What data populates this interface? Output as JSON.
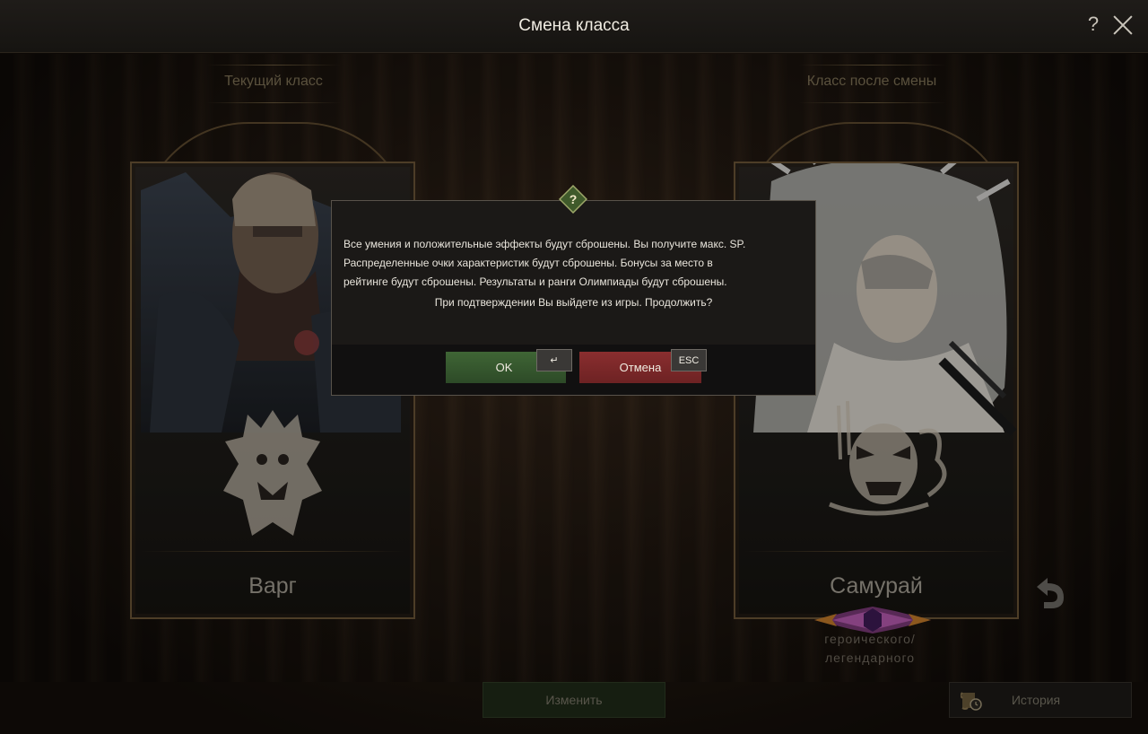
{
  "window": {
    "title": "Смена класса"
  },
  "left_panel": {
    "label": "Текущий класс",
    "class_name": "Варг",
    "emblem": "wolf-crest-emblem"
  },
  "right_panel": {
    "label": "Класс после смены",
    "class_name": "Самурай",
    "emblem": "oni-mask-emblem",
    "rank_line1": "героического/",
    "rank_line2": "легендарного"
  },
  "buttons": {
    "change": "Изменить",
    "history": "История"
  },
  "dialog": {
    "icon": "question-icon",
    "message_line1": "Все умения и положительные эффекты будут сброшены. Вы получите макс. SP.",
    "message_line2": "Распределенные очки характеристик будут сброшены. Бонусы за место в",
    "message_line3": "рейтинге будут сброшены. Результаты и ранги Олимпиады будут сброшены.",
    "question": "При подтверждении Вы выйдете из игры. Продолжить?",
    "ok": "OK",
    "cancel": "Отмена",
    "ok_key": "↵",
    "cancel_key": "ESC"
  },
  "colors": {
    "ok": "#3f6535",
    "cancel": "#8a2e2f",
    "gold": "#6b5536"
  }
}
